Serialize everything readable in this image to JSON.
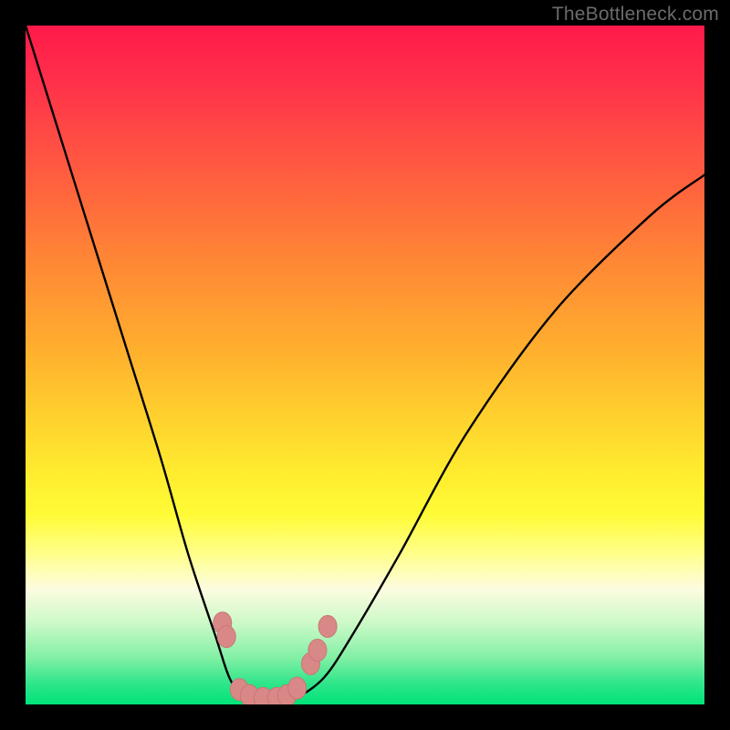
{
  "watermark": "TheBottleneck.com",
  "chart_data": {
    "type": "line",
    "title": "",
    "xlabel": "",
    "ylabel": "",
    "xlim": [
      0,
      100
    ],
    "ylim": [
      0,
      100
    ],
    "series": [
      {
        "name": "bottleneck-curve",
        "x": [
          0,
          5,
          10,
          15,
          20,
          24,
          28,
          30,
          32,
          34,
          35,
          37,
          40,
          44,
          48,
          55,
          65,
          78,
          92,
          100
        ],
        "y": [
          100,
          84,
          68,
          52,
          36,
          22,
          10,
          4,
          1,
          0,
          0,
          0,
          1,
          4,
          10,
          22,
          40,
          58,
          72,
          78
        ]
      }
    ],
    "markers": [
      {
        "name": "left-cluster-1",
        "x": 29.0,
        "y": 12.0
      },
      {
        "name": "left-cluster-2",
        "x": 29.6,
        "y": 10.0
      },
      {
        "name": "bottom-1",
        "x": 31.5,
        "y": 2.2
      },
      {
        "name": "bottom-2",
        "x": 33.0,
        "y": 1.3
      },
      {
        "name": "bottom-3",
        "x": 35.0,
        "y": 0.9
      },
      {
        "name": "bottom-4",
        "x": 37.0,
        "y": 0.9
      },
      {
        "name": "bottom-5",
        "x": 38.5,
        "y": 1.3
      },
      {
        "name": "bottom-6",
        "x": 40.0,
        "y": 2.4
      },
      {
        "name": "right-cluster-1",
        "x": 42.0,
        "y": 6.0
      },
      {
        "name": "right-cluster-2",
        "x": 43.0,
        "y": 8.0
      },
      {
        "name": "right-cluster-3",
        "x": 44.5,
        "y": 11.5
      }
    ],
    "colors": {
      "curve_stroke": "#000000",
      "marker_fill": "#d98888",
      "marker_stroke": "#c87777"
    }
  }
}
